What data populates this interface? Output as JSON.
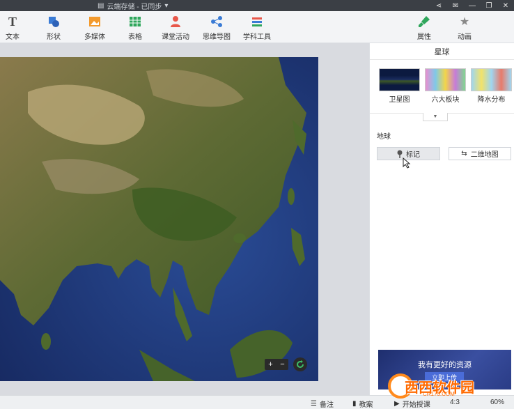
{
  "titlebar": {
    "doc_title": "云端存储 - 已同步",
    "share_icon": "share-icon",
    "mail_icon": "mail-icon"
  },
  "toolbar": {
    "tools": [
      {
        "label": "文本",
        "icon": "text-icon"
      },
      {
        "label": "形状",
        "icon": "shape-icon"
      },
      {
        "label": "多媒体",
        "icon": "image-icon"
      },
      {
        "label": "表格",
        "icon": "table-icon"
      },
      {
        "label": "课堂活动",
        "icon": "person-icon"
      },
      {
        "label": "思维导图",
        "icon": "mindmap-icon"
      },
      {
        "label": "学科工具",
        "icon": "book-icon"
      }
    ],
    "right_tabs": [
      {
        "label": "属性",
        "icon": "brush-icon"
      },
      {
        "label": "动画",
        "icon": "star-icon"
      }
    ]
  },
  "panel": {
    "title": "星球",
    "thumbnails": [
      "卫星图",
      "六大板块",
      "降水分布"
    ],
    "section_label": "地球",
    "mark_button": "标记",
    "map2d_button": "二维地图",
    "banner_title": "我有更好的资源",
    "banner_button": "立即上传"
  },
  "canvas": {
    "zoom_plus": "+",
    "zoom_minus": "−"
  },
  "statusbar": {
    "notes": "备注",
    "lesson": "教案",
    "start": "开始授课",
    "ratio": "4:3",
    "zoom": "60%"
  },
  "watermark": {
    "text": "西西软件园",
    "url": "CR173.COM"
  },
  "colors": {
    "titlebar": "#3b3f45",
    "accent": "#4a6cd8"
  }
}
